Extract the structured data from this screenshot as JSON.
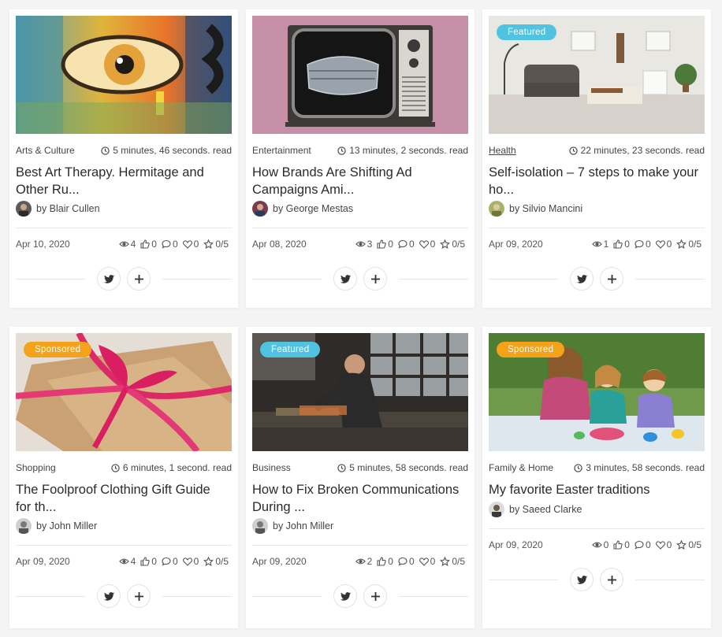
{
  "colors": {
    "featured_badge": "#4fc3e0",
    "sponsored_badge": "#f4a21a",
    "text_dark": "#2b2b2b",
    "text_muted": "#555555"
  },
  "cards": [
    {
      "badge": "",
      "category": "Arts & Culture",
      "read_time": "5 minutes, 46 seconds. read",
      "title": "Best Art Therapy. Hermitage and Other Ru...",
      "author": "by Blair Cullen",
      "date": "Apr 10, 2020",
      "views": "4",
      "likes": "0",
      "comments": "0",
      "hearts": "0",
      "rating": "0/5",
      "image": "colorful graffiti eye"
    },
    {
      "badge": "",
      "category": "Entertainment",
      "read_time": "13 minutes, 2 seconds. read",
      "title": "How Brands Are Shifting Ad Campaigns Ami...",
      "author": "by George Mestas",
      "date": "Apr 08, 2020",
      "views": "3",
      "likes": "0",
      "comments": "0",
      "hearts": "0",
      "rating": "0/5",
      "image": "retro TV with face mask on pink"
    },
    {
      "badge": "Featured",
      "category": "Health",
      "read_time": "22 minutes, 23 seconds. read",
      "title": "Self-isolation – 7 steps to make your ho...",
      "author": "by Silvio Mancini",
      "date": "Apr 09, 2020",
      "views": "1",
      "likes": "0",
      "comments": "0",
      "hearts": "0",
      "rating": "0/5",
      "image": "living room interior"
    },
    {
      "badge": "Sponsored",
      "category": "Shopping",
      "read_time": "6 minutes, 1 second. read",
      "title": "The Foolproof Clothing Gift Guide for th...",
      "author": "by John Miller",
      "date": "Apr 09, 2020",
      "views": "4",
      "likes": "0",
      "comments": "0",
      "hearts": "0",
      "rating": "0/5",
      "image": "gift box with pink ribbon"
    },
    {
      "badge": "Featured",
      "category": "Business",
      "read_time": "5 minutes, 58 seconds. read",
      "title": "How to Fix Broken Communications During ...",
      "author": "by John Miller",
      "date": "Apr 09, 2020",
      "views": "2",
      "likes": "0",
      "comments": "0",
      "hearts": "0",
      "rating": "0/5",
      "image": "man working in workshop"
    },
    {
      "badge": "Sponsored",
      "category": "Family & Home",
      "read_time": "3 minutes, 58 seconds. read",
      "title": "My favorite Easter traditions",
      "author": "by Saeed Clarke",
      "date": "Apr 09, 2020",
      "views": "0",
      "likes": "0",
      "comments": "0",
      "hearts": "0",
      "rating": "0/5",
      "image": "family painting easter eggs"
    }
  ],
  "icons": {
    "clock": "clock-icon",
    "eye": "eye-icon",
    "like": "thumbs-up-icon",
    "comment": "comment-icon",
    "heart": "heart-icon",
    "star": "star-icon",
    "twitter": "twitter-icon",
    "plus": "plus-icon"
  }
}
